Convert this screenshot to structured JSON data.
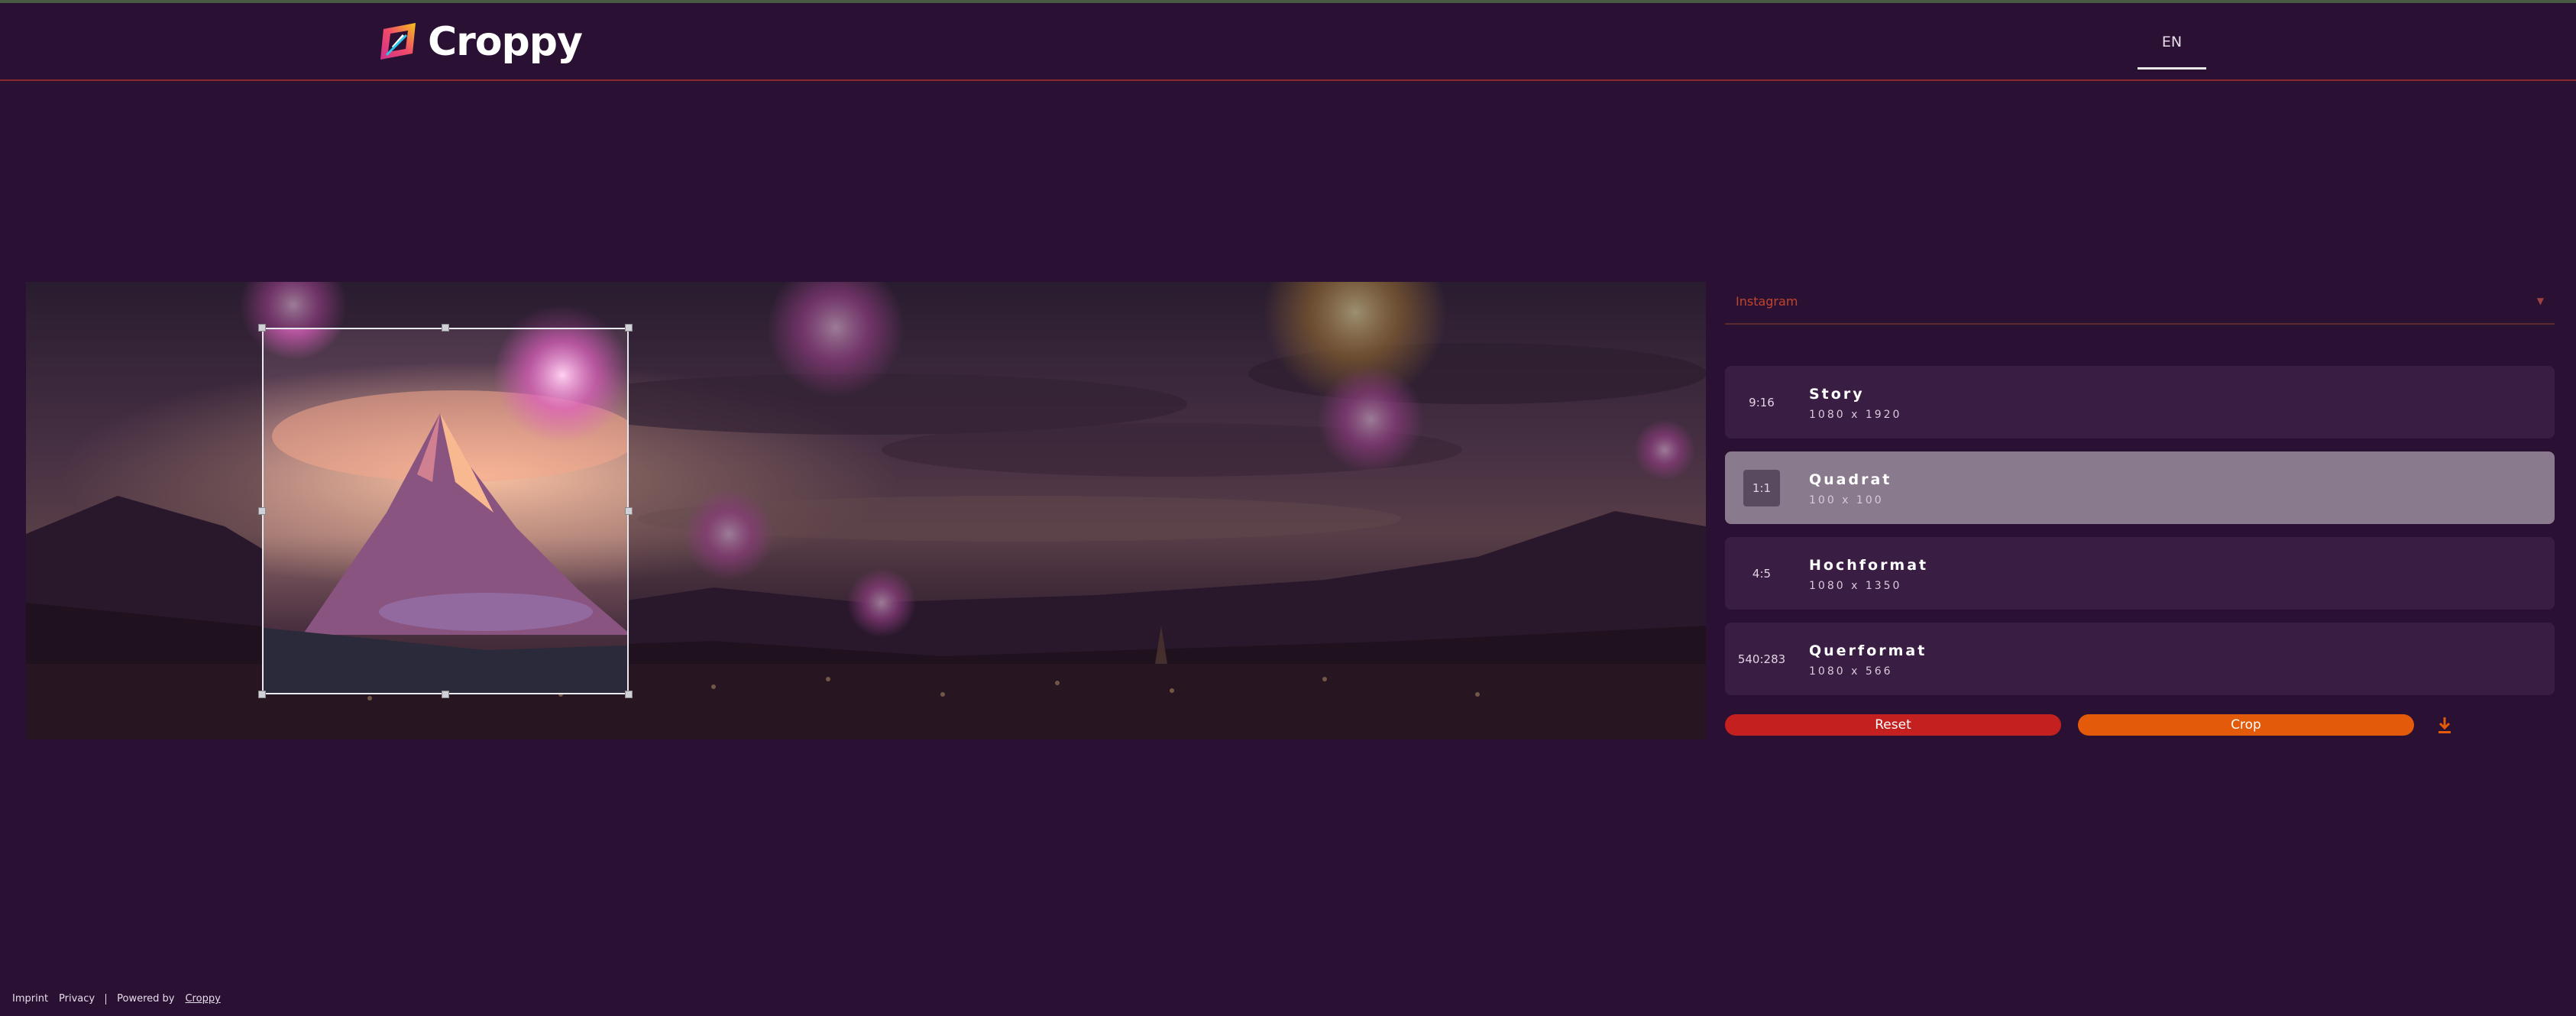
{
  "app": {
    "name": "Croppy"
  },
  "header": {
    "language": "EN"
  },
  "platform_select": {
    "value": "Instagram"
  },
  "presets": [
    {
      "ratio": "9:16",
      "title": "Story",
      "size": "1080 x 1920",
      "active": false
    },
    {
      "ratio": "1:1",
      "title": "Quadrat",
      "size": "100 x 100",
      "active": true
    },
    {
      "ratio": "4:5",
      "title": "Hochformat",
      "size": "1080 x 1350",
      "active": false
    },
    {
      "ratio": "540:283",
      "title": "Querformat",
      "size": "1080 x 566",
      "active": false
    }
  ],
  "actions": {
    "reset": "Reset",
    "crop": "Crop"
  },
  "footer": {
    "imprint": "Imprint",
    "privacy": "Privacy",
    "powered_by": "Powered by",
    "powered_link": "Croppy"
  },
  "colors": {
    "background": "#2a1133",
    "reset": "#c42020",
    "crop": "#e35a0a",
    "active_preset": "#8a7a8e"
  },
  "icons": {
    "download": "download-icon",
    "dropdown": "chevron-down-icon"
  }
}
